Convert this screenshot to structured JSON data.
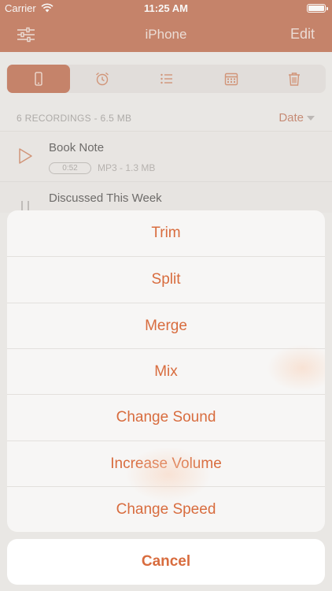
{
  "status_bar": {
    "carrier": "Carrier",
    "time": "11:25 AM"
  },
  "navbar": {
    "title": "iPhone",
    "edit_label": "Edit"
  },
  "segments": [
    {
      "icon": "phone-icon",
      "active": true
    },
    {
      "icon": "alarm-clock-icon",
      "active": false
    },
    {
      "icon": "list-icon",
      "active": false
    },
    {
      "icon": "calendar-icon",
      "active": false
    },
    {
      "icon": "trash-icon",
      "active": false
    }
  ],
  "list_header": {
    "count": "6 RECORDINGS - 6.5 MB",
    "sort": "Date"
  },
  "recordings": [
    {
      "name": "Book Note",
      "duration": "0:52",
      "meta": "MP3 - 1.3 MB",
      "icon": "play-icon"
    },
    {
      "name": "Discussed This Week",
      "icon": "pause-icon"
    }
  ],
  "action_sheet": {
    "actions": [
      "Trim",
      "Split",
      "Merge",
      "Mix",
      "Change Sound",
      "Increase Volume",
      "Change Speed"
    ],
    "cancel_label": "Cancel"
  },
  "colors": {
    "accent": "#b14d28",
    "action_text": "#d86c3e"
  }
}
